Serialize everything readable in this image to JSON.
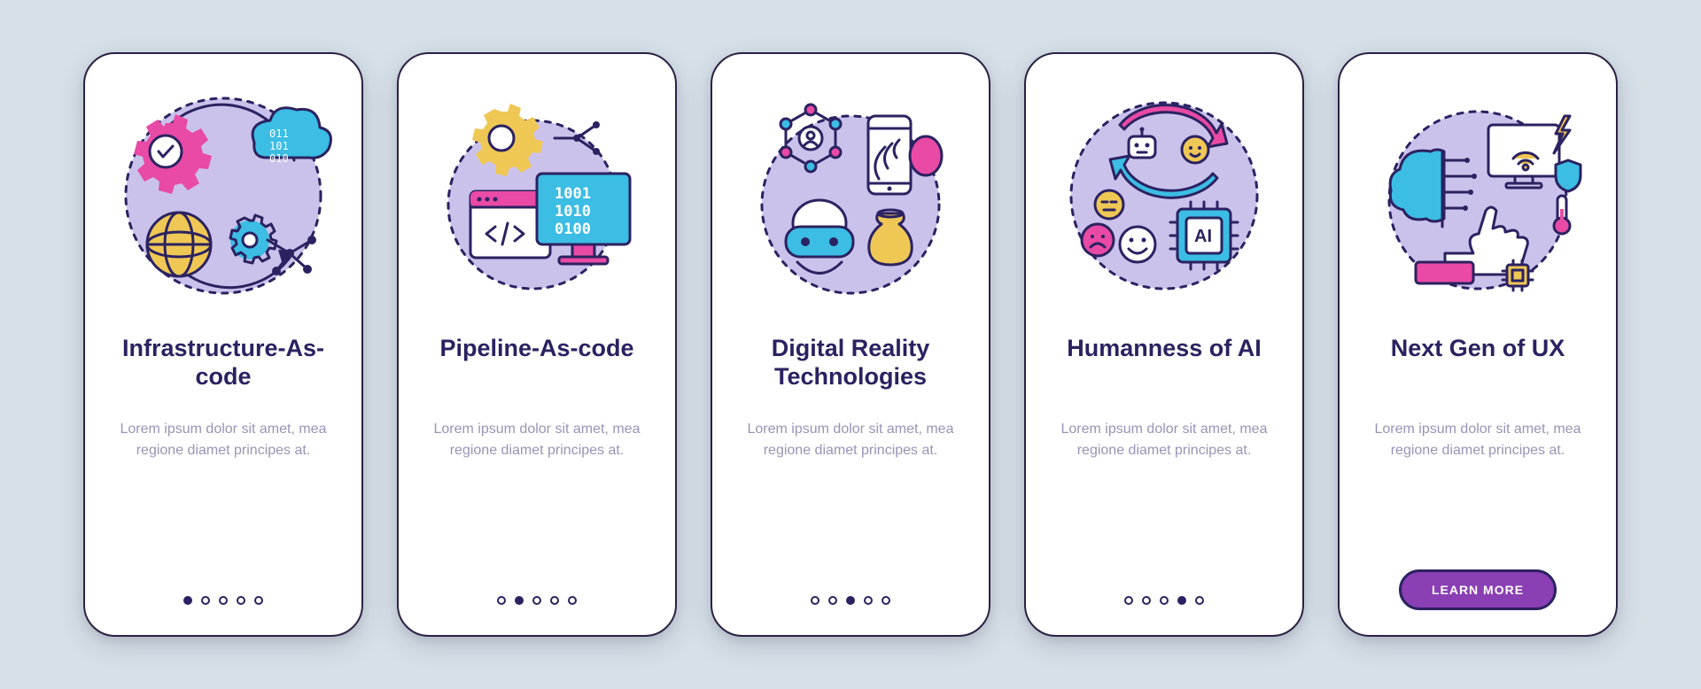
{
  "cards": [
    {
      "title": "Infrastructure-As-code",
      "description": "Lorem ipsum dolor sit amet, mea regione diamet principes at.",
      "activeDot": 0
    },
    {
      "title": "Pipeline-As-code",
      "description": "Lorem ipsum dolor sit amet, mea regione diamet principes at.",
      "activeDot": 1
    },
    {
      "title": "Digital Reality Technologies",
      "description": "Lorem ipsum dolor sit amet, mea regione diamet principes at.",
      "activeDot": 2
    },
    {
      "title": "Humanness of AI",
      "description": "Lorem ipsum dolor sit amet, mea regione diamet principes at.",
      "activeDot": 3
    },
    {
      "title": "Next Gen of UX",
      "description": "Lorem ipsum dolor sit amet, mea regione diamet principes at.",
      "cta": "LEARN MORE"
    }
  ],
  "dotCount": 5,
  "colors": {
    "background": "#d6e0e7",
    "cardBorder": "#2b2144",
    "title": "#2b2261",
    "description": "#9a93b6",
    "ctaBg": "#8a3fb5",
    "lavender": "#cbc2ec",
    "cyan": "#3bbde4",
    "magenta": "#e84aa5",
    "yellow": "#efc755"
  }
}
